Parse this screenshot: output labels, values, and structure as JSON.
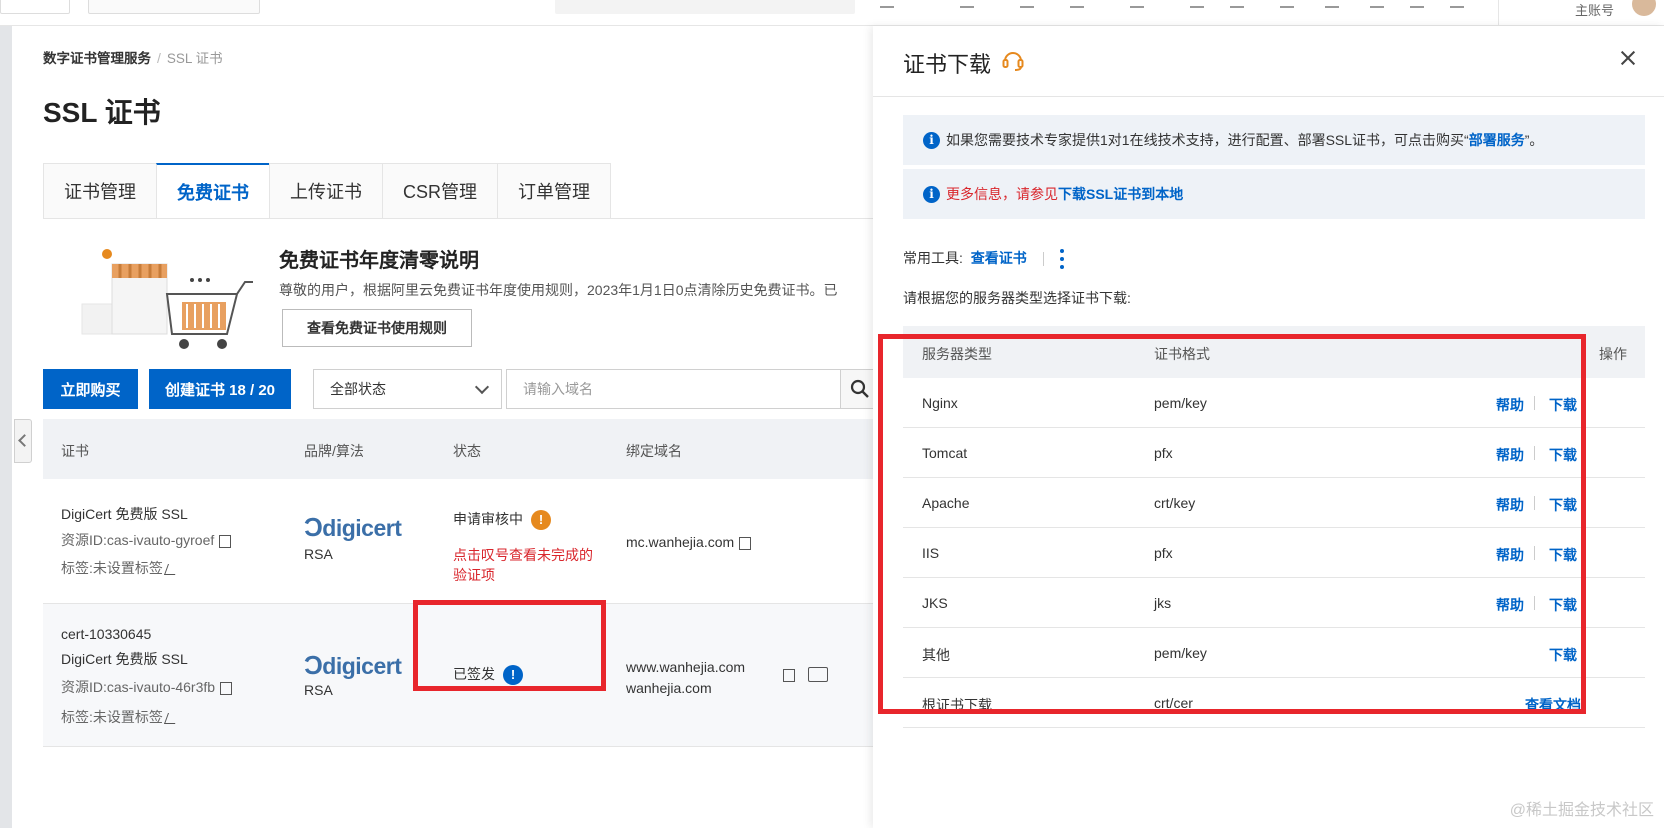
{
  "topbar": {
    "account_label": "主账号"
  },
  "breadcrumb": {
    "root": "数字证书管理服务",
    "separator": "/",
    "current": "SSL 证书"
  },
  "page_title": "SSL 证书",
  "tabs": [
    {
      "label": "证书管理"
    },
    {
      "label": "免费证书"
    },
    {
      "label": "上传证书"
    },
    {
      "label": "CSR管理"
    },
    {
      "label": "订单管理"
    }
  ],
  "notice": {
    "title": "免费证书年度清零说明",
    "text": "尊敬的用户，根据阿里云免费证书年度使用规则，2023年1月1日0点清除历史免费证书。已",
    "button": "查看免费证书使用规则"
  },
  "toolbar": {
    "buy_label": "立即购买",
    "create_label": "创建证书 18 / 20",
    "status_select": "全部状态",
    "domain_placeholder": "请输入域名"
  },
  "cert_table": {
    "headers": [
      "证书",
      "品牌/算法",
      "状态",
      "绑定域名"
    ],
    "rows": [
      {
        "id_line": "",
        "name": "DigiCert 免费版 SSL",
        "resource": "资源ID:cas-ivauto-gyroef",
        "tag": "标签:未设置标签",
        "brand": "digicert",
        "algo": "RSA",
        "status": "申请审核中",
        "status_icon": "!",
        "status_hint": "点击叹号查看未完成的验证项",
        "domain1": "mc.wanhejia.com",
        "domain2": ""
      },
      {
        "id_line": "cert-10330645",
        "name": "DigiCert 免费版 SSL",
        "resource": "资源ID:cas-ivauto-46r3fb",
        "tag": "标签:未设置标签",
        "brand": "digicert",
        "algo": "RSA",
        "status": "已签发",
        "status_icon": "!",
        "status_hint": "",
        "domain1": "www.wanhejia.com",
        "domain2": "wanhejia.com"
      }
    ]
  },
  "drawer": {
    "title": "证书下载",
    "info1_prefix": "如果您需要技术专家提供1对1在线技术支持，进行配置、部署SSL证书，可点击购买“",
    "info1_link": "部署服务",
    "info1_suffix": "”。",
    "info2_prefix": "更多信息，请参见",
    "info2_link": "下载SSL证书到本地",
    "tools_label": "常用工具:",
    "tools_link": "查看证书",
    "select_label": "请根据您的服务器类型选择证书下载:",
    "headers": {
      "server": "服务器类型",
      "format": "证书格式",
      "action": "操作"
    },
    "rows": [
      {
        "server": "Nginx",
        "format": "pem/key",
        "help": "帮助",
        "download": "下载"
      },
      {
        "server": "Tomcat",
        "format": "pfx",
        "help": "帮助",
        "download": "下载"
      },
      {
        "server": "Apache",
        "format": "crt/key",
        "help": "帮助",
        "download": "下载"
      },
      {
        "server": "IIS",
        "format": "pfx",
        "help": "帮助",
        "download": "下载"
      },
      {
        "server": "JKS",
        "format": "jks",
        "help": "帮助",
        "download": "下载"
      },
      {
        "server": "其他",
        "format": "pem/key",
        "help": "",
        "download": "下载"
      },
      {
        "server": "根证书下载",
        "format": "crt/cer",
        "help": "",
        "download": "查看文档"
      }
    ]
  },
  "watermark": "@稀土掘金技术社区",
  "colors": {
    "primary": "#0064c8",
    "highlight": "#e8262c",
    "warning": "#e6891e",
    "error_text": "#d9262c"
  }
}
